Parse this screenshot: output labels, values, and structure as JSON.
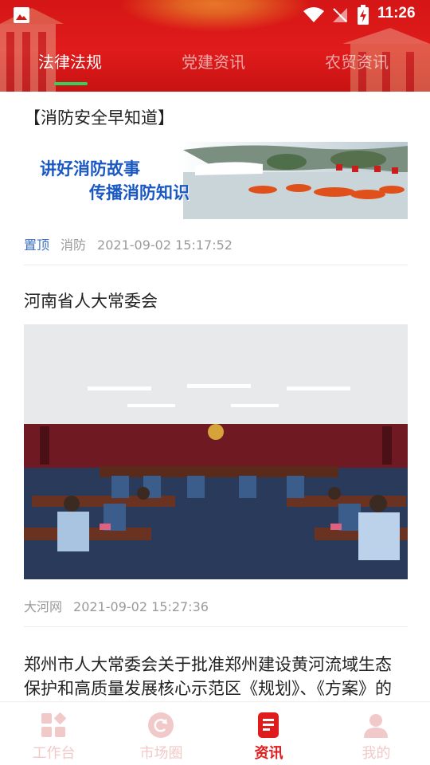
{
  "status_bar": {
    "time": "11:26"
  },
  "tabs": [
    {
      "label": "法律法规",
      "active": true
    },
    {
      "label": "党建资讯",
      "active": false
    },
    {
      "label": "农贸资讯",
      "active": false
    }
  ],
  "articles": [
    {
      "title": "【消防安全早知道】",
      "banner_line1": "讲好消防故事",
      "banner_line2": "传播消防知识",
      "pinned": "置顶",
      "source": "消防",
      "time": "2021-09-02 15:17:52"
    },
    {
      "title": "河南省人大常委会",
      "source": "大河网",
      "time": "2021-09-02 15:27:36"
    },
    {
      "title": "郑州市人大常委会关于批准郑州建设黄河流域生态保护和高质量发展核心示范区《规划》、《方案》的决议"
    }
  ],
  "bottom_nav": [
    {
      "label": "工作台",
      "icon": "grid-icon",
      "active": false
    },
    {
      "label": "市场圈",
      "icon": "refresh-circle-icon",
      "active": false
    },
    {
      "label": "资讯",
      "icon": "news-icon",
      "active": true
    },
    {
      "label": "我的",
      "icon": "user-icon",
      "active": false
    }
  ],
  "colors": {
    "brand_red": "#e01b1b",
    "tab_indicator": "#2fd35a",
    "pinned_blue": "#3b6fc2",
    "inactive_nav": "#f2c9c9"
  }
}
